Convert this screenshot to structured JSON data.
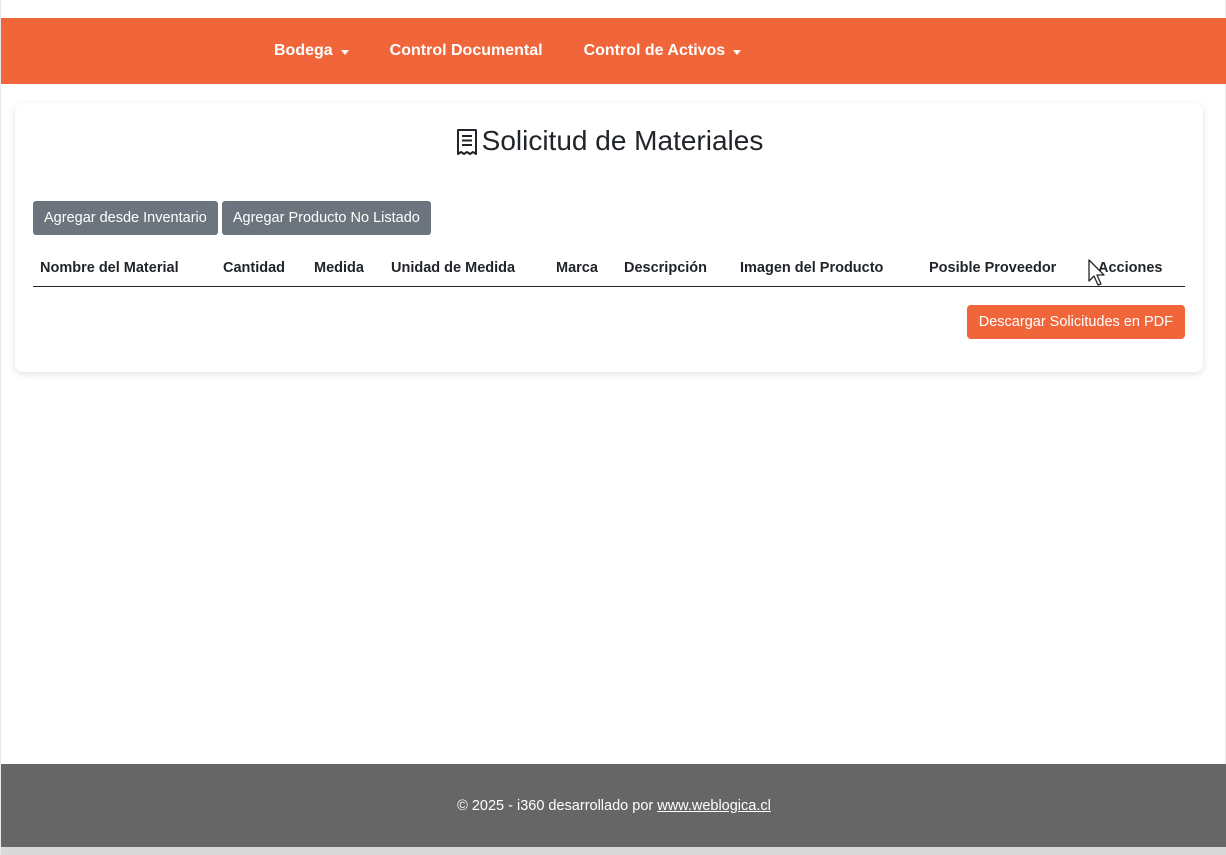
{
  "navbar": {
    "items": [
      {
        "label": "Bodega",
        "dropdown": true
      },
      {
        "label": "Control Documental",
        "dropdown": false
      },
      {
        "label": "Control de Activos",
        "dropdown": true
      }
    ],
    "color": "#f0663a"
  },
  "page": {
    "title": "Solicitud de Materiales",
    "title_icon": "receipt-icon"
  },
  "buttons": {
    "add_from_inventory": "Agregar desde Inventario",
    "add_unlisted": "Agregar Producto No Listado",
    "download_pdf": "Descargar Solicitudes en PDF"
  },
  "table": {
    "columns": [
      "Nombre del Material",
      "Cantidad",
      "Medida",
      "Unidad de Medida",
      "Marca",
      "Descripción",
      "Imagen del Producto",
      "Posible Proveedor",
      "Acciones"
    ],
    "rows": []
  },
  "footer": {
    "text": "© 2025 - i360 desarrollado por",
    "link": "www.weblogica.cl"
  }
}
